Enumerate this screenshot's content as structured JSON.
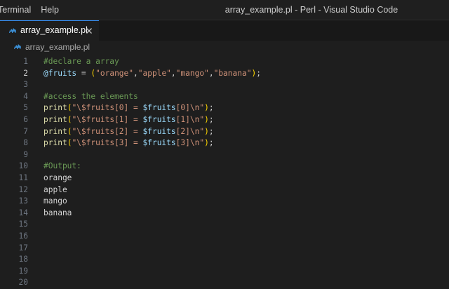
{
  "menu": {
    "terminal": "Terminal",
    "help": "Help"
  },
  "window": {
    "title": "array_example.pl - Perl - Visual Studio Code"
  },
  "tab": {
    "label": "array_example.pl",
    "close": "×",
    "icon": "perl-camel-icon"
  },
  "breadcrumb": {
    "label": "array_example.pl",
    "icon": "perl-camel-icon"
  },
  "colors": {
    "accent": "#3794ff",
    "comment": "#6a9955",
    "variable": "#9cdcfe",
    "string": "#ce9178",
    "function": "#dcdcaa",
    "bracket": "#ffd700",
    "perl_icon": "#3b8fd6"
  },
  "editor": {
    "active_line": 2,
    "lines": [
      {
        "n": "1",
        "tokens": [
          [
            "comment",
            "#declare a array"
          ]
        ]
      },
      {
        "n": "2",
        "tokens": [
          [
            "var",
            "@fruits"
          ],
          [
            "op",
            " = "
          ],
          [
            "paren",
            "("
          ],
          [
            "str",
            "\"orange\""
          ],
          [
            "op",
            ","
          ],
          [
            "str",
            "\"apple\""
          ],
          [
            "op",
            ","
          ],
          [
            "str",
            "\"mango\""
          ],
          [
            "op",
            ","
          ],
          [
            "str",
            "\"banana\""
          ],
          [
            "paren",
            ")"
          ],
          [
            "op",
            ";"
          ]
        ]
      },
      {
        "n": "3",
        "tokens": []
      },
      {
        "n": "4",
        "tokens": [
          [
            "comment",
            "#access the elements"
          ]
        ]
      },
      {
        "n": "5",
        "tokens": [
          [
            "fn",
            "print"
          ],
          [
            "paren",
            "("
          ],
          [
            "str",
            "\"\\$fruits[0] = "
          ],
          [
            "var",
            "$fruits"
          ],
          [
            "str",
            "[0]\\n\""
          ],
          [
            "paren",
            ")"
          ],
          [
            "op",
            ";"
          ]
        ]
      },
      {
        "n": "6",
        "tokens": [
          [
            "fn",
            "print"
          ],
          [
            "paren",
            "("
          ],
          [
            "str",
            "\"\\$fruits[1] = "
          ],
          [
            "var",
            "$fruits"
          ],
          [
            "str",
            "[1]\\n\""
          ],
          [
            "paren",
            ")"
          ],
          [
            "op",
            ";"
          ]
        ]
      },
      {
        "n": "7",
        "tokens": [
          [
            "fn",
            "print"
          ],
          [
            "paren",
            "("
          ],
          [
            "str",
            "\"\\$fruits[2] = "
          ],
          [
            "var",
            "$fruits"
          ],
          [
            "str",
            "[2]\\n\""
          ],
          [
            "paren",
            ")"
          ],
          [
            "op",
            ";"
          ]
        ]
      },
      {
        "n": "8",
        "tokens": [
          [
            "fn",
            "print"
          ],
          [
            "paren",
            "("
          ],
          [
            "str",
            "\"\\$fruits[3] = "
          ],
          [
            "var",
            "$fruits"
          ],
          [
            "str",
            "[3]\\n\""
          ],
          [
            "paren",
            ")"
          ],
          [
            "op",
            ";"
          ]
        ]
      },
      {
        "n": "9",
        "tokens": []
      },
      {
        "n": "10",
        "tokens": [
          [
            "comment",
            "#Output:"
          ]
        ]
      },
      {
        "n": "11",
        "tokens": [
          [
            "plain",
            "orange"
          ]
        ]
      },
      {
        "n": "12",
        "tokens": [
          [
            "plain",
            "apple"
          ]
        ]
      },
      {
        "n": "13",
        "tokens": [
          [
            "plain",
            "mango"
          ]
        ]
      },
      {
        "n": "14",
        "tokens": [
          [
            "plain",
            "banana"
          ]
        ]
      },
      {
        "n": "15",
        "tokens": []
      },
      {
        "n": "16",
        "tokens": []
      },
      {
        "n": "17",
        "tokens": []
      },
      {
        "n": "18",
        "tokens": []
      },
      {
        "n": "19",
        "tokens": []
      },
      {
        "n": "20",
        "tokens": []
      }
    ]
  }
}
